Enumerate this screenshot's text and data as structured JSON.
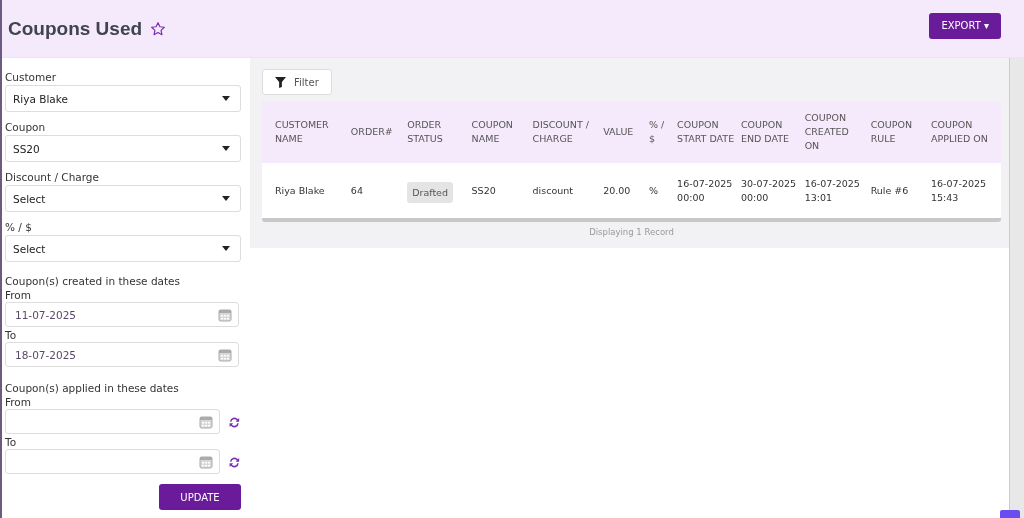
{
  "page": {
    "title": "Coupons Used",
    "favorite": false,
    "export_button": "EXPORT ▾"
  },
  "filters": {
    "selects": [
      {
        "label": "Customer",
        "value": "Riya Blake"
      },
      {
        "label": "Coupon",
        "value": "SS20"
      },
      {
        "label": "Discount / Charge",
        "value": "Select"
      },
      {
        "label": "% / $",
        "value": "Select"
      }
    ],
    "date_groups": [
      {
        "heading": "Coupon(s) created in these dates",
        "resettable": false,
        "fields": [
          {
            "label": "From",
            "value": "11-07-2025"
          },
          {
            "label": "To",
            "value": "18-07-2025"
          }
        ]
      },
      {
        "heading": "Coupon(s) applied in these dates",
        "resettable": true,
        "fields": [
          {
            "label": "From"
          },
          {
            "label": "To"
          }
        ]
      }
    ],
    "update_button": "UPDATE"
  },
  "filter_button": "Filter",
  "table": {
    "columns": [
      "CUSTOMER NAME",
      "ORDER#",
      "ORDER STATUS",
      "COUPON NAME",
      "DISCOUNT / CHARGE",
      "VALUE",
      "% / $",
      "COUPON START DATE",
      "COUPON END DATE",
      "COUPON CREATED ON",
      "COUPON RULE",
      "COUPON APPLIED ON"
    ],
    "rows": [
      {
        "cells": [
          {
            "text": "Riya Blake"
          },
          {
            "text": "64"
          },
          {
            "text": "Drafted",
            "kind": "badge"
          },
          {
            "text": "SS20"
          },
          {
            "text": "discount"
          },
          {
            "text": "20.00"
          },
          {
            "text": "%"
          },
          {
            "text": "16-07-2025 00:00"
          },
          {
            "text": "30-07-2025 00:00"
          },
          {
            "text": "16-07-2025 13:01"
          },
          {
            "text": "Rule #6"
          },
          {
            "text": "16-07-2025 15:43"
          }
        ]
      }
    ]
  },
  "footer": "Displaying 1 Record"
}
